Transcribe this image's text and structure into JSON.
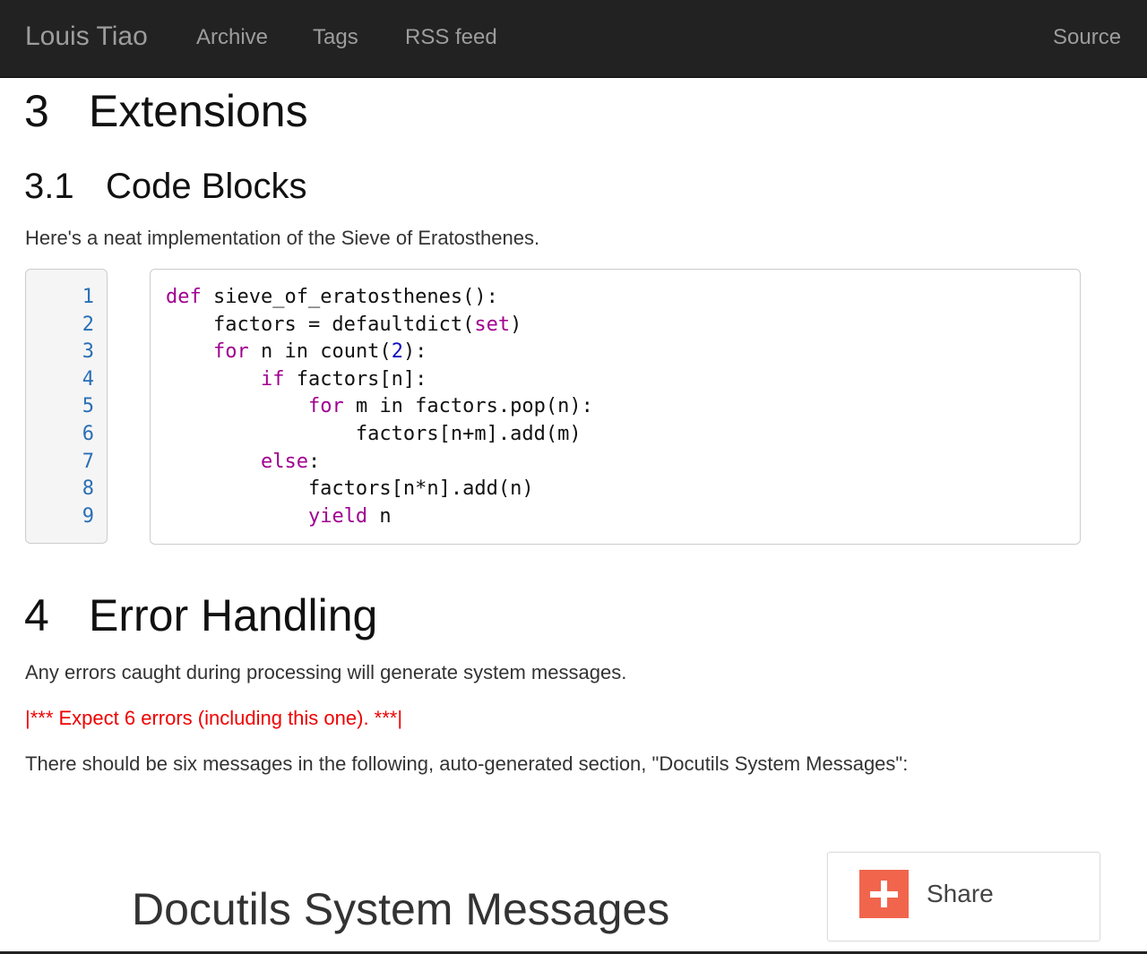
{
  "navbar": {
    "brand": "Louis Tiao",
    "links": [
      "Archive",
      "Tags",
      "RSS feed"
    ],
    "source": "Source"
  },
  "section3": {
    "number": "3",
    "title": "Extensions"
  },
  "section31": {
    "number": "3.1",
    "title": "Code Blocks",
    "intro": "Here's a neat implementation of the Sieve of Eratosthenes."
  },
  "code": {
    "line_numbers": [
      "1",
      "2",
      "3",
      "4",
      "5",
      "6",
      "7",
      "8",
      "9"
    ],
    "lines": [
      [
        {
          "t": "def",
          "c": "kw"
        },
        {
          "t": " sieve_of_eratosthenes():"
        }
      ],
      [
        {
          "t": "    factors = defaultdict("
        },
        {
          "t": "set",
          "c": "kw"
        },
        {
          "t": ")"
        }
      ],
      [
        {
          "t": "    "
        },
        {
          "t": "for",
          "c": "kw"
        },
        {
          "t": " n in count("
        },
        {
          "t": "2",
          "c": "nm"
        },
        {
          "t": "):"
        }
      ],
      [
        {
          "t": "        "
        },
        {
          "t": "if",
          "c": "kw"
        },
        {
          "t": " factors[n]:"
        }
      ],
      [
        {
          "t": "            "
        },
        {
          "t": "for",
          "c": "kw"
        },
        {
          "t": " m in factors.pop(n):"
        }
      ],
      [
        {
          "t": "                factors[n+m].add(m)"
        }
      ],
      [
        {
          "t": "        "
        },
        {
          "t": "else",
          "c": "kw"
        },
        {
          "t": ":"
        }
      ],
      [
        {
          "t": "            factors[n*n].add(n)"
        }
      ],
      [
        {
          "t": "            "
        },
        {
          "t": "yield",
          "c": "kw"
        },
        {
          "t": " n"
        }
      ]
    ]
  },
  "section4": {
    "number": "4",
    "title": "Error Handling",
    "p1": "Any errors caught during processing will generate system messages.",
    "error": "|*** Expect 6 errors (including this one). ***|",
    "p2": "There should be six messages in the following, auto-generated section, \"Docutils System Messages\":"
  },
  "docutils_title": "Docutils System Messages",
  "share": {
    "label": "Share",
    "icon": "plus-icon",
    "icon_color": "#f1654c"
  }
}
